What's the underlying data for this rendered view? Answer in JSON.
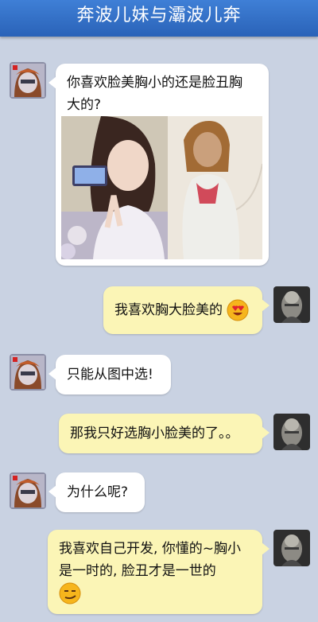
{
  "header": {
    "title": "奔波儿妹与灞波儿奔"
  },
  "messages": [
    {
      "text_line1": "你喜欢脸美胸小的还是脸丑胸",
      "text_line2": "大的?"
    },
    {
      "text": "我喜欢胸大脸美的",
      "emoji": "heart-eyes-emoji"
    },
    {
      "text": "只能从图中选!"
    },
    {
      "text": "那我只好选胸小脸美的了。。"
    },
    {
      "text": "为什么呢?"
    },
    {
      "text_line1": "我喜欢自己开发, 你懂的~胸小",
      "text_line2": "是一时的, 脸丑才是一世的",
      "emoji": "smirk-emoji"
    }
  ],
  "colors": {
    "header": "#2f6fc8",
    "background": "#c9d2e2",
    "left_bubble": "#ffffff",
    "right_bubble": "#fbf5b6"
  }
}
